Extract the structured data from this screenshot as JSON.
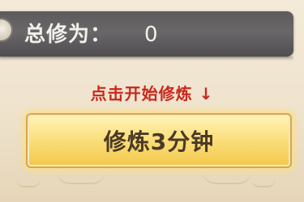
{
  "stats": {
    "label": "总修为：",
    "value": "0",
    "icon": "orb-icon"
  },
  "hint": {
    "text": "点击开始修炼",
    "arrow": "↓"
  },
  "action": {
    "button_label": "修炼3分钟"
  },
  "colors": {
    "hint": "#c8281e",
    "button_gold": "#f3c84a",
    "bar_dark": "#5c5a5c"
  }
}
